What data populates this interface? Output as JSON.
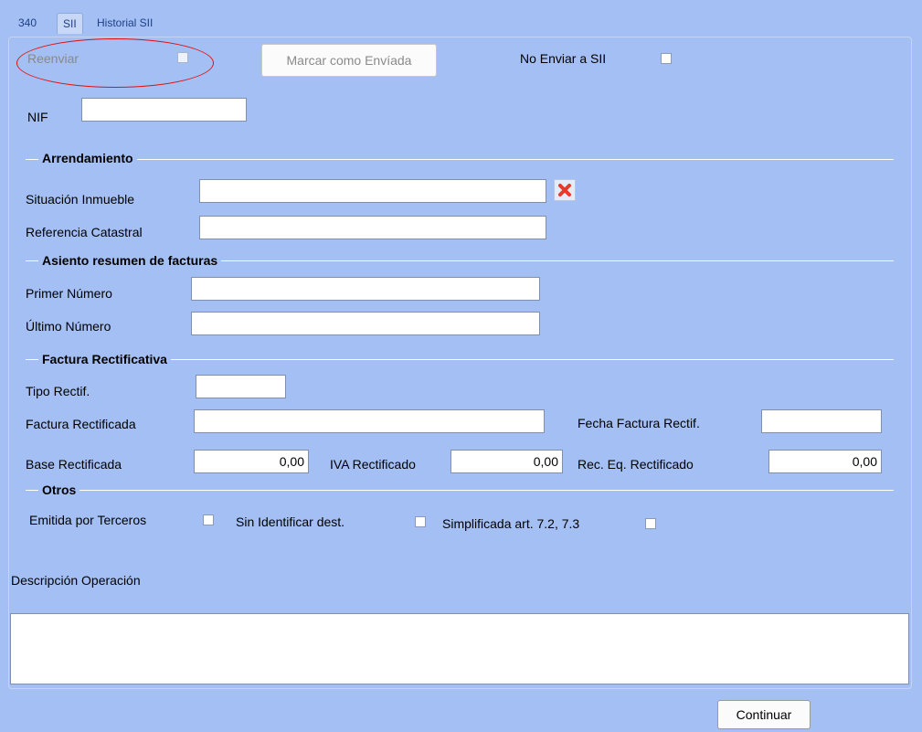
{
  "tabs": [
    {
      "label": "340"
    },
    {
      "label": "SII"
    },
    {
      "label": "Historial SII"
    }
  ],
  "top": {
    "reenviar_label": "Reenviar",
    "marcar_button": "Marcar como Envíada",
    "no_enviar_label": "No Enviar a SII"
  },
  "nif": {
    "label": "NIF",
    "value": ""
  },
  "arrendamiento": {
    "title": "Arrendamiento",
    "situacion_label": "Situación Inmueble",
    "situacion_value": "",
    "referencia_label": "Referencia Catastral",
    "referencia_value": ""
  },
  "asiento": {
    "title": "Asiento resumen de facturas",
    "primer_label": "Primer Número",
    "primer_value": "",
    "ultimo_label": "Último Número",
    "ultimo_value": ""
  },
  "rectificativa": {
    "title": "Factura Rectificativa",
    "tipo_label": "Tipo Rectif.",
    "factura_label": "Factura Rectificada",
    "fecha_label": "Fecha Factura Rectif.",
    "base_label": "Base Rectificada",
    "base_value": "0,00",
    "iva_label": "IVA Rectificado",
    "iva_value": "0,00",
    "rec_label": "Rec. Eq. Rectificado",
    "rec_value": "0,00"
  },
  "otros": {
    "title": "Otros",
    "emitida_label": "Emitida por Terceros",
    "sin_identificar_label": "Sin Identificar dest.",
    "simplificada_label": "Simplificada art. 7.2, 7.3"
  },
  "descripcion": {
    "label": "Descripción Operación",
    "value": ""
  },
  "continuar_button": "Continuar",
  "colors": {
    "background": "#a4bff3",
    "annotation": "#e01010",
    "clear_icon": "#e8392b"
  },
  "icons": {
    "clear": "red-x-icon"
  }
}
